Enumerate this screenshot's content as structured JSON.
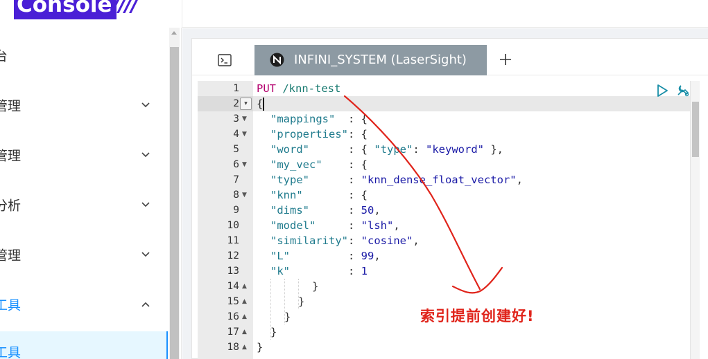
{
  "brand": {
    "logo_text": "Console",
    "logo_stripes": "////"
  },
  "sidebar": {
    "items": [
      {
        "label": "台",
        "has_chevron": false
      },
      {
        "label": "管理",
        "has_chevron": true
      },
      {
        "label": "管理",
        "has_chevron": true
      },
      {
        "label": "分析",
        "has_chevron": true
      },
      {
        "label": "管理",
        "has_chevron": true
      },
      {
        "label": "工具",
        "has_chevron": true,
        "expanded": true,
        "active": true
      }
    ],
    "active_subitem": "工具"
  },
  "console": {
    "tabs": [
      {
        "label": "INFINI_SYSTEM (LaserSight)",
        "active": true
      }
    ],
    "terminal_icon": "terminal-icon",
    "add_tab_icon": "plus-icon",
    "run_icon": "play-icon",
    "wrench_icon": "wrench-icon"
  },
  "editor": {
    "line_numbers": [
      "1",
      "2",
      "3",
      "4",
      "5",
      "6",
      "7",
      "8",
      "9",
      "10",
      "11",
      "12",
      "13",
      "14",
      "15",
      "16",
      "17",
      "18"
    ],
    "request": {
      "method": "PUT",
      "path": "/knn-test"
    },
    "lines": [
      {
        "n": 2,
        "text": "{"
      },
      {
        "n": 3,
        "key": "\"mappings\"",
        "sep": "  : {"
      },
      {
        "n": 4,
        "key": "\"properties\"",
        "sep": ": {"
      },
      {
        "n": 5,
        "key": "\"word\"",
        "sep": "      : { ",
        "inner_key": "\"type\"",
        "inner_sep": ": ",
        "inner_val": "\"keyword\"",
        "tail": " },"
      },
      {
        "n": 6,
        "key": "\"my_vec\"",
        "sep": "    : {"
      },
      {
        "n": 7,
        "key": "\"type\"",
        "sep": "      : ",
        "val": "\"knn_dense_float_vector\"",
        "tail": ","
      },
      {
        "n": 8,
        "key": "\"knn\"",
        "sep": "       : {"
      },
      {
        "n": 9,
        "key": "\"dims\"",
        "sep": "      : ",
        "val": "50",
        "tail": ","
      },
      {
        "n": 10,
        "key": "\"model\"",
        "sep": "     : ",
        "val": "\"lsh\"",
        "tail": ","
      },
      {
        "n": 11,
        "key": "\"similarity\"",
        "sep": ": ",
        "val": "\"cosine\"",
        "tail": ","
      },
      {
        "n": 12,
        "key": "\"L\"",
        "sep": "         : ",
        "val": "99",
        "tail": ","
      },
      {
        "n": 13,
        "key": "\"k\"",
        "sep": "         : ",
        "val": "1",
        "tail": ""
      },
      {
        "n": 14,
        "text": "}"
      },
      {
        "n": 15,
        "text": "}"
      },
      {
        "n": 16,
        "text": "}"
      },
      {
        "n": 17,
        "text": "}"
      },
      {
        "n": 18,
        "text": "}"
      }
    ]
  },
  "annotation": {
    "text": "索引提前创建好!"
  },
  "colors": {
    "accent": "#1890ff",
    "tab_active_bg": "#8d9aa3",
    "annotation": "#e0241b",
    "logo": "#4a1fd6"
  }
}
